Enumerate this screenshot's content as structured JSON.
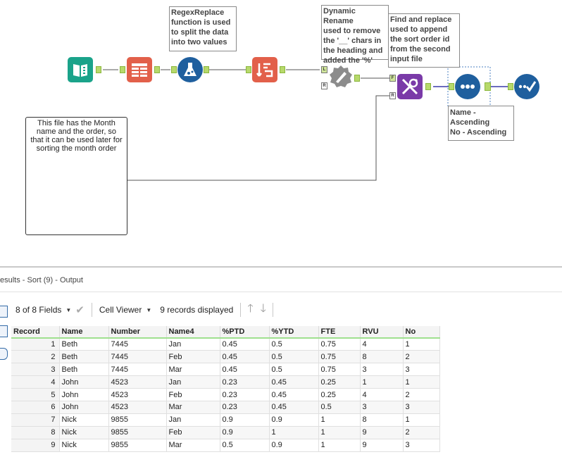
{
  "notes": {
    "regex": [
      "RegexReplace",
      "function is used",
      "to split the data",
      "into two values"
    ],
    "rename": [
      "Dynamic Rename",
      "used to remove",
      "the '__' chars in",
      "the heading and",
      "added the '%'"
    ],
    "findreplace": [
      "Find and replace",
      "used to append",
      "the sort order id",
      "from the second",
      "input file"
    ],
    "sort": [
      "Name -",
      "Ascending",
      "No - Ascending"
    ]
  },
  "comment": [
    "This file has the Month",
    "name and the order, so",
    "that it can be used later for",
    "sorting the month order"
  ],
  "anchors": {
    "left": "L",
    "right": "R",
    "find": "F"
  },
  "results": {
    "title": "esults - Sort (9) - Output",
    "fields_label": "8 of 8 Fields",
    "viewer_label": "Cell Viewer",
    "records_label": "9 records displayed"
  },
  "table": {
    "columns": [
      "Record",
      "Name",
      "Number",
      "Name4",
      "%PTD",
      "%YTD",
      "FTE",
      "RVU",
      "No"
    ],
    "rows": [
      [
        "1",
        "Beth",
        "7445",
        "Jan",
        "0.45",
        "0.5",
        "0.75",
        "4",
        "1"
      ],
      [
        "2",
        "Beth",
        "7445",
        "Feb",
        "0.45",
        "0.5",
        "0.75",
        "8",
        "2"
      ],
      [
        "3",
        "Beth",
        "7445",
        "Mar",
        "0.45",
        "0.5",
        "0.75",
        "3",
        "3"
      ],
      [
        "4",
        "John",
        "4523",
        "Jan",
        "0.23",
        "0.45",
        "0.25",
        "1",
        "1"
      ],
      [
        "5",
        "John",
        "4523",
        "Feb",
        "0.23",
        "0.45",
        "0.25",
        "4",
        "2"
      ],
      [
        "6",
        "John",
        "4523",
        "Mar",
        "0.23",
        "0.45",
        "0.5",
        "3",
        "3"
      ],
      [
        "7",
        "Nick",
        "9855",
        "Jan",
        "0.9",
        "0.9",
        "1",
        "8",
        "1"
      ],
      [
        "8",
        "Nick",
        "9855",
        "Feb",
        "0.9",
        "1",
        "1",
        "9",
        "2"
      ],
      [
        "9",
        "Nick",
        "9855",
        "Mar",
        "0.5",
        "0.9",
        "1",
        "9",
        "3"
      ]
    ]
  },
  "colors": {
    "input": "#1aa38a",
    "select": "#e2604a",
    "formula": "#1f5f9e",
    "rename": "#8c8c8c",
    "findreplace": "#7a3aa8",
    "sort": "#1f5f9e",
    "anchor": "#b7d96b"
  },
  "icons": {
    "input": "book-input-icon",
    "select": "select-columns-icon",
    "formula": "flask-icon",
    "multirow": "arrows-icon",
    "rename": "dynamic-rename-icon",
    "findreplace": "magnify-cross-icon",
    "sort": "dots-icon",
    "browse": "check-icon"
  }
}
